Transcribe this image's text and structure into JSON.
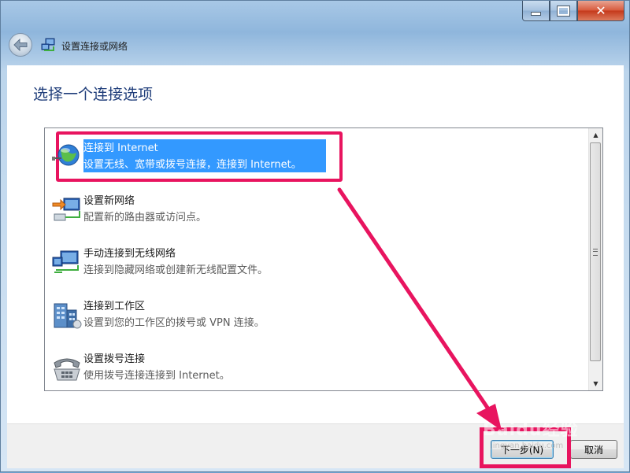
{
  "window": {
    "title": "设置连接或网络",
    "caption": {
      "minimize": "minimize",
      "maximize": "maximize",
      "close": "✕"
    }
  },
  "main": {
    "heading": "选择一个连接选项",
    "options": [
      {
        "title": "连接到 Internet",
        "desc": "设置无线、宽带或拨号连接，连接到 Internet。",
        "icon": "globe-network-icon",
        "selected": true
      },
      {
        "title": "设置新网络",
        "desc": "配置新的路由器或访问点。",
        "icon": "new-network-icon",
        "selected": false
      },
      {
        "title": "手动连接到无线网络",
        "desc": "连接到隐藏网络或创建新无线配置文件。",
        "icon": "wireless-network-icon",
        "selected": false
      },
      {
        "title": "连接到工作区",
        "desc": "设置到您的工作区的拨号或 VPN 连接。",
        "icon": "workplace-building-icon",
        "selected": false
      },
      {
        "title": "设置拨号连接",
        "desc": "使用拨号连接连接到 Internet。",
        "icon": "dialup-telephone-icon",
        "selected": false
      }
    ]
  },
  "footer": {
    "next_label": "下一步(N)",
    "cancel_label": "取消"
  },
  "watermark": {
    "text": "Baidu经验",
    "sub": "jingyan.baidu.com"
  },
  "colors": {
    "highlight": "#e8145f",
    "selection": "#3399ff",
    "heading": "#1f3d7a"
  }
}
